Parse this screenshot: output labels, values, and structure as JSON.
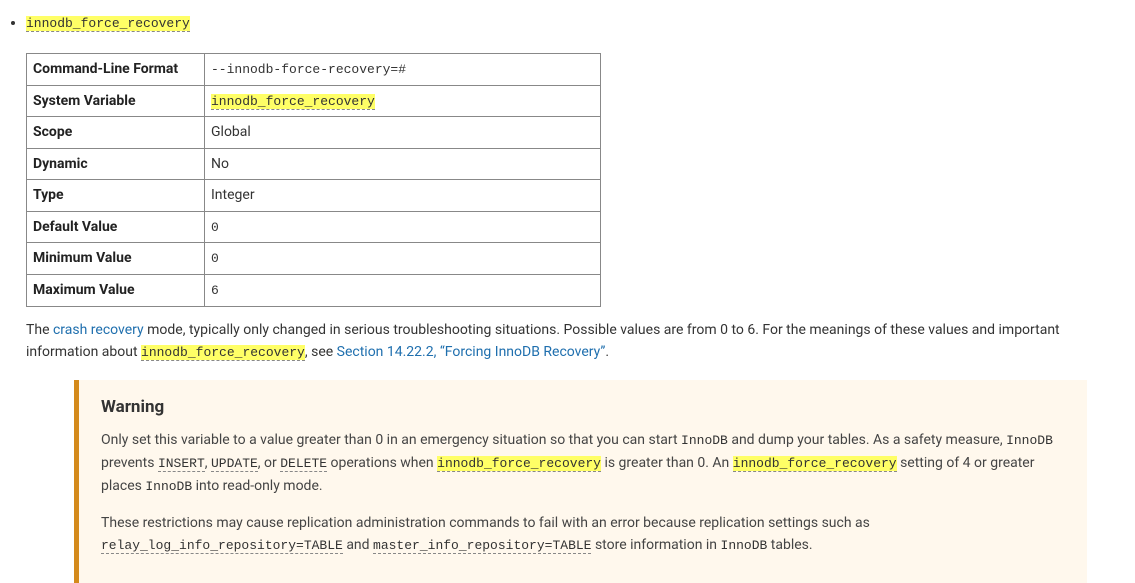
{
  "heading_code": "innodb_force_recovery",
  "table": {
    "rows": [
      {
        "label": "Command-Line Format",
        "value": "--innodb-force-recovery=#",
        "mono": true,
        "hl": false
      },
      {
        "label": "System Variable",
        "value": "innodb_force_recovery",
        "mono": true,
        "hl": true,
        "link": true
      },
      {
        "label": "Scope",
        "value": "Global",
        "mono": false,
        "hl": false
      },
      {
        "label": "Dynamic",
        "value": "No",
        "mono": false,
        "hl": false
      },
      {
        "label": "Type",
        "value": "Integer",
        "mono": false,
        "hl": false
      },
      {
        "label": "Default Value",
        "value": "0",
        "mono": true,
        "hl": false
      },
      {
        "label": "Minimum Value",
        "value": "0",
        "mono": true,
        "hl": false
      },
      {
        "label": "Maximum Value",
        "value": "6",
        "mono": true,
        "hl": false
      }
    ]
  },
  "desc": {
    "t1": "The ",
    "crash_recovery": "crash recovery",
    "t2": " mode, typically only changed in serious troubleshooting situations. Possible values are from 0 to 6. For the meanings of these values and important information about ",
    "force_rec": "innodb_force_recovery",
    "t3": ", see ",
    "section_link": "Section 14.22.2, “Forcing InnoDB Recovery”",
    "t4": "."
  },
  "warning": {
    "title": "Warning",
    "p1": {
      "t1": "Only set this variable to a value greater than 0 in an emergency situation so that you can start ",
      "innodb1": "InnoDB",
      "t2": " and dump your tables. As a safety measure, ",
      "innodb2": "InnoDB",
      "t3": " prevents ",
      "insert": "INSERT",
      "comma1": ", ",
      "update": "UPDATE",
      "comma2": ", or ",
      "delete": "DELETE",
      "t4": " operations when ",
      "force1": "innodb_force_recovery",
      "t5": " is greater than 0. An ",
      "force2": "innodb_force_recovery",
      "t6": " setting of 4 or greater places ",
      "innodb3": "InnoDB",
      "t7": " into read-only mode."
    },
    "p2": {
      "t1": "These restrictions may cause replication administration commands to fail with an error because replication settings such as ",
      "relay": "relay_log_info_repository=TABLE",
      "t2": " and ",
      "master": "master_info_repository=TABLE",
      "t3": " store information in ",
      "innodb": "InnoDB",
      "t4": " tables."
    }
  }
}
